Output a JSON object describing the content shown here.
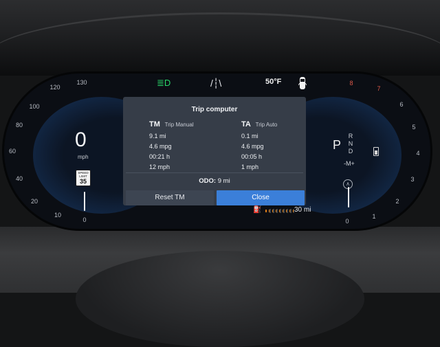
{
  "top_indicators": {
    "headlights_icon": "low-beam-headlights-icon",
    "road_icon": "lane-assist-road-icon",
    "temperature": "50°F",
    "car_icon": "car-doors-icon"
  },
  "speedometer": {
    "speed": "0",
    "unit": "mph",
    "ticks": [
      "0",
      "10",
      "20",
      "40",
      "60",
      "80",
      "100",
      "120",
      "130"
    ],
    "speed_limit_label": "SPEED LIMIT",
    "speed_limit_value": "35"
  },
  "tachometer": {
    "ticks": [
      "0",
      "1",
      "2",
      "3",
      "4",
      "5",
      "6",
      "7",
      "8"
    ],
    "redline_ticks": [
      "7",
      "8"
    ],
    "gear_selected": "P",
    "gear_options": [
      "R",
      "N",
      "D"
    ],
    "manual_mode": "-M+",
    "rpm_level": 0,
    "eco_icon": "drive-mode-icon",
    "battery_icon": "battery-icon"
  },
  "trip_computer": {
    "title": "Trip computer",
    "trip_manual": {
      "code": "TM",
      "label": "Trip Manual",
      "distance": "9.1 mi",
      "consumption": "4.6 mpg",
      "time": "00:21 h",
      "avg_speed": "12 mph"
    },
    "trip_auto": {
      "code": "TA",
      "label": "Trip Auto",
      "distance": "0.1 mi",
      "consumption": "4.6 mpg",
      "time": "00:05 h",
      "avg_speed": "1 mph"
    },
    "odo_label": "ODO:",
    "odo_value": "9 mi",
    "reset_button": "Reset TM",
    "close_button": "Close"
  },
  "fuel": {
    "icon": "fuel-pump-icon",
    "range": "30 mi"
  },
  "colors": {
    "accent": "#3b7fd9",
    "indicator_green": "#28d86a",
    "fuel_warning": "#f08a1a",
    "dialog_bg": "#363d48"
  }
}
